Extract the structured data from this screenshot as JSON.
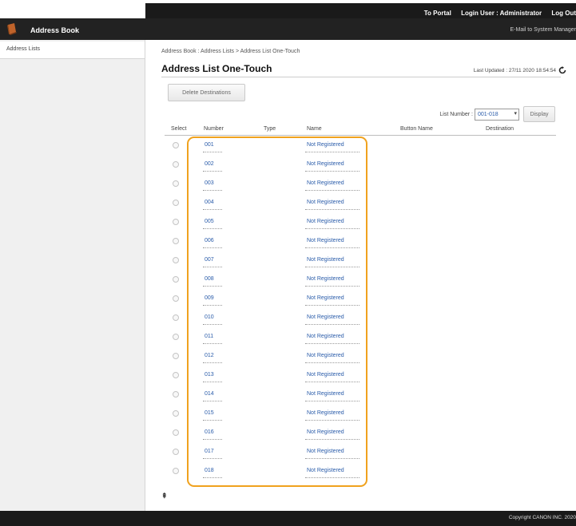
{
  "header": {
    "to_portal": "To Portal",
    "login_user": "Login User : Administrator",
    "log_out": "Log Out",
    "app_title": "Address Book",
    "email_link": "E-Mail to System Manager"
  },
  "sidebar": {
    "items": [
      {
        "label": "Address Lists"
      }
    ]
  },
  "main": {
    "breadcrumb": "Address Book : Address Lists > Address List One-Touch",
    "title": "Address List One-Touch",
    "last_updated": "Last Updated : 27/11 2020 18:54:54",
    "delete_button": "Delete Destinations",
    "list_number_label": "List Number :",
    "list_number_value": "001-018",
    "display_button": "Display",
    "columns": {
      "select": "Select",
      "number": "Number",
      "type": "Type",
      "name": "Name",
      "button_name": "Button Name",
      "destination": "Destination"
    },
    "rows": [
      {
        "number": "001",
        "name": "Not Registered"
      },
      {
        "number": "002",
        "name": "Not Registered"
      },
      {
        "number": "003",
        "name": "Not Registered"
      },
      {
        "number": "004",
        "name": "Not Registered"
      },
      {
        "number": "005",
        "name": "Not Registered"
      },
      {
        "number": "006",
        "name": "Not Registered"
      },
      {
        "number": "007",
        "name": "Not Registered"
      },
      {
        "number": "008",
        "name": "Not Registered"
      },
      {
        "number": "009",
        "name": "Not Registered"
      },
      {
        "number": "010",
        "name": "Not Registered"
      },
      {
        "number": "011",
        "name": "Not Registered"
      },
      {
        "number": "012",
        "name": "Not Registered"
      },
      {
        "number": "013",
        "name": "Not Registered"
      },
      {
        "number": "014",
        "name": "Not Registered"
      },
      {
        "number": "015",
        "name": "Not Registered"
      },
      {
        "number": "016",
        "name": "Not Registered"
      },
      {
        "number": "017",
        "name": "Not Registered"
      },
      {
        "number": "018",
        "name": "Not Registered"
      }
    ],
    "top_icon": "⇞"
  },
  "footer": {
    "copyright": "Copyright CANON INC. 2020"
  },
  "colors": {
    "header_bg": "#222222",
    "link_blue": "#2a5caa",
    "highlight_orange": "#f0a21e",
    "icon_brown": "#c0632a"
  }
}
